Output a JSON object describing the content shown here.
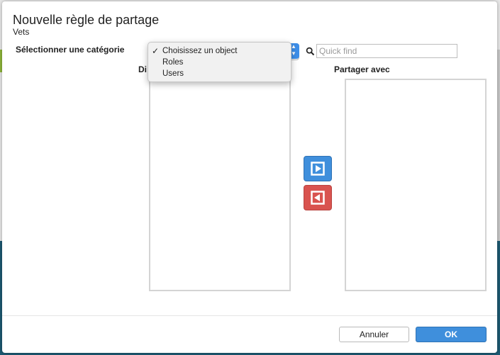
{
  "dialog": {
    "title": "Nouvelle règle de partage",
    "subtitle": "Vets"
  },
  "category": {
    "label": "Sélectionner une catégorie",
    "selected": "Choisissez un object",
    "options": [
      "Choisissez un object",
      "Roles",
      "Users"
    ]
  },
  "search": {
    "placeholder": "Quick find",
    "value": ""
  },
  "lists": {
    "available_label": "Di",
    "shared_label": "Partager avec"
  },
  "buttons": {
    "cancel": "Annuler",
    "ok": "OK"
  },
  "icons": {
    "search": "search-icon",
    "add": "play-right-icon",
    "remove": "play-left-icon",
    "check": "checkmark-icon"
  },
  "colors": {
    "accent": "#3f8fdc",
    "danger": "#d9534f",
    "stepper": "#3d8ee8"
  }
}
